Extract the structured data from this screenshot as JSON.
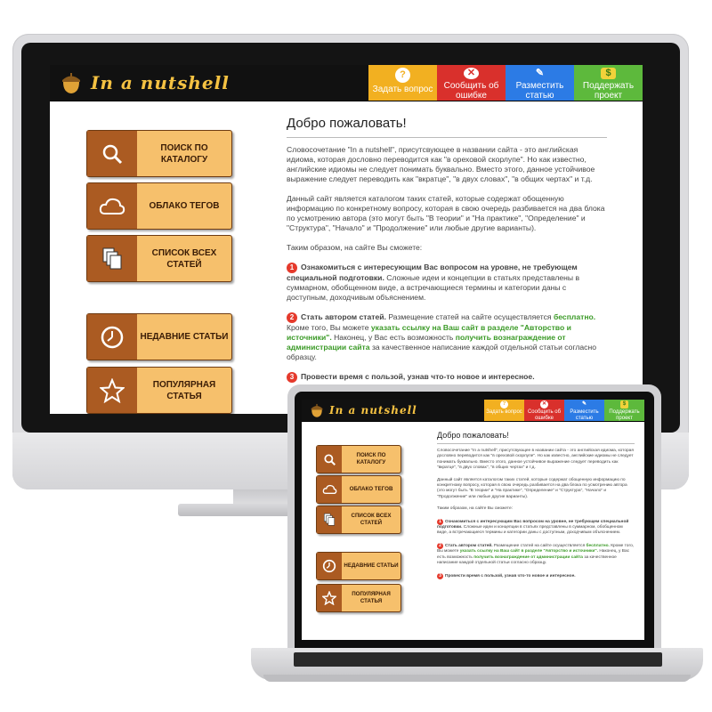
{
  "site": {
    "logo_text": "In a nutshell",
    "header_buttons": [
      {
        "label": "Задать вопрос",
        "icon": "question-icon",
        "color": "#f2b021"
      },
      {
        "label": "Сообщить об ошибке",
        "icon": "error-icon",
        "color": "#d9302c"
      },
      {
        "label": "Разместить статью",
        "icon": "pencil-icon",
        "color": "#2c7be5"
      },
      {
        "label": "Поддержать проект",
        "icon": "money-icon",
        "color": "#5db93c"
      }
    ],
    "sidebar": [
      {
        "label": "ПОИСК ПО КАТАЛОГУ",
        "icon": "magnifier-icon"
      },
      {
        "label": "ОБЛАКО ТЕГОВ",
        "icon": "cloud-icon"
      },
      {
        "label": "СПИСОК ВСЕХ СТАТЕЙ",
        "icon": "documents-icon"
      },
      {
        "label": "НЕДАВНИЕ СТАТЬИ",
        "icon": "clock-icon"
      },
      {
        "label": "ПОПУЛЯРНАЯ СТАТЬЯ",
        "icon": "star-icon"
      }
    ],
    "welcome_title": "Добро пожаловать!",
    "intro_p1": "Словосочетание \"In a nutshell\", присутсвующее в названии сайта - это английская идиома, которая дословно переводится как \"в ореховой скорлупе\". Но как известно, английские идиомы не следует понимать буквально. Вместо этого, данное устойчивое выражение следует переводить как \"вкратце\", \"в двух словах\", \"в общих чертах\" и т.д.",
    "intro_p2": "Данный сайт является каталогом таких статей, которые содержат обощенную информацию по конкретному вопросу, которая в свою очередь разбивается на два блока по усмотрению автора (это могут быть \"В теории\" и \"На практике\", \"Определение\" и \"Структура\", \"Начало\" и \"Продолжение\" или любые другие варианты).",
    "intro_p3": "Таким образом, на сайте Вы сможете:",
    "item1_num": "1",
    "item1_bold": "Ознакомиться с интересующим Вас вопросом на уровне, не требующем специальной подготовки.",
    "item1_text": "Сложные идеи и концепции в статьях представлены в суммарном, обобщенном виде, а встречающиеся термины и категории даны с доступным, доходчивым объяснением.",
    "item2_num": "2",
    "item2_bold": "Стать автором статей.",
    "item2_text_a": "Размещение статей на сайте осуществляется",
    "item2_free": "бесплатно.",
    "item2_text_b": "Кроме того, Вы можете",
    "item2_link1": "указать ссылку на Ваш сайт в разделе \"Авторство и источники\".",
    "item2_text_c": "Наконец, у Вас есть возможность",
    "item2_link2": "получить вознаграждение от администрации сайта",
    "item2_text_d": "за качественное написание каждой отдельной статьи согласно образцу.",
    "item3_num": "3",
    "item3_bold": "Провести время с пользой, узнав что-то новое и интересное."
  }
}
